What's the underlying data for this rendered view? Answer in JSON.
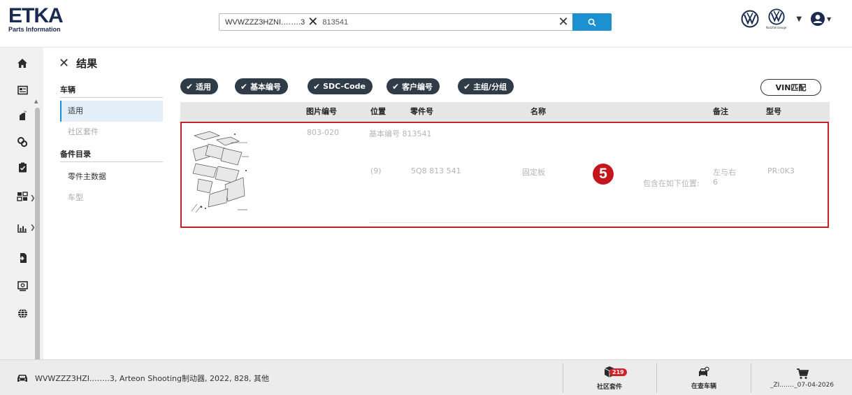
{
  "header": {
    "logo_title": "ETKA",
    "logo_subtitle": "Parts Information",
    "vin_chip": "WVWZZZ3HZNI.…….3",
    "search_query": "813541",
    "brand_label": "Nutzfahrzeuge"
  },
  "nav": {
    "title": "结果",
    "section_vehicle": "车辆",
    "items_vehicle": [
      {
        "label": "适用",
        "active": true
      },
      {
        "label": "社区套件",
        "muted": true
      }
    ],
    "section_catalog": "备件目录",
    "items_catalog": [
      {
        "label": "零件主数据"
      },
      {
        "label": "车型",
        "muted": true
      }
    ]
  },
  "filters": {
    "chips": [
      "适用",
      "基本编号",
      "SDC-Code",
      "客户编号",
      "主组/分组"
    ],
    "vin_match_label": "VIN匹配"
  },
  "table": {
    "headers": {
      "picture_no": "图片编号",
      "position": "位置",
      "part_no": "零件号",
      "name": "名称",
      "remark": "备注",
      "model": "型号"
    },
    "row": {
      "picture_no": "803-020",
      "basic_no": "基本编号 813541",
      "position": "(9)",
      "part_no": "5Q8  813  541",
      "name": "固定板",
      "contains_label": "包含在如下位置:",
      "remark_line1": "左与右",
      "remark_line2": "6",
      "model": "PR:0K3"
    },
    "annotation_number": "5"
  },
  "statusbar": {
    "vehicle_text": "WVWZZZ3HZI.…….3, Arteon Shooting制动器, 2022, 828, 其他",
    "community_count": "219",
    "community_label": "社区套件",
    "vehicle_check_label": "在查车辆",
    "order_text": "_ZI.……_07-04-2026"
  }
}
